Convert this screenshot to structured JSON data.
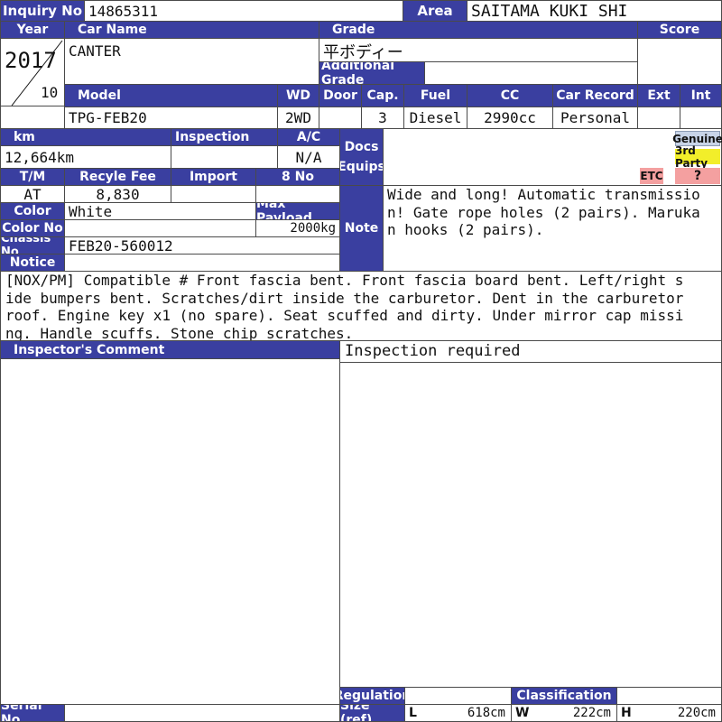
{
  "header": {
    "inquiry_label": "Inquiry No",
    "inquiry_no": "14865311",
    "area_label": "Area",
    "area": "SAITAMA KUKI SHI"
  },
  "row1": {
    "year_label": "Year",
    "car_name_label": "Car Name",
    "grade_label": "Grade",
    "score_label": "Score",
    "year": "2017",
    "month": "10",
    "car_name": "CANTER",
    "grade": "平ボディー",
    "additional_grade_label": "Additional Grade",
    "additional_grade": "",
    "score": ""
  },
  "row2": {
    "model_label": "Model",
    "wd_label": "WD",
    "door_label": "Door",
    "cap_label": "Cap.",
    "fuel_label": "Fuel",
    "cc_label": "CC",
    "car_record_label": "Car Record",
    "ext_label": "Ext",
    "int_label": "Int",
    "model": "TPG-FEB20",
    "wd": "2WD",
    "door": "",
    "cap": "3",
    "fuel": "Diesel",
    "cc": "2990cc",
    "car_record": "Personal",
    "ext": "",
    "int": ""
  },
  "details": {
    "km_label": "km",
    "km": "12,664km",
    "inspection_label": "Inspection",
    "inspection": "",
    "ac_label": "A/C",
    "ac": "N/A",
    "docs_label": "Docs",
    "equips_label": "Equips",
    "tm_label": "T/M",
    "tm": "AT",
    "recycle_label": "Recyle Fee",
    "recycle": "8,830",
    "import_label": "Import",
    "import": "",
    "eight_no_label": "8 No",
    "eight_no": "",
    "color_label": "Color",
    "color": "White",
    "max_payload_label": "Max Payload",
    "max_payload": "2000kg",
    "color_no_label": "Color No",
    "color_no": "",
    "chassis_label": "Chassis No",
    "chassis": "FEB20-560012",
    "notice_label": "Notice",
    "note_label": "Note",
    "note": "Wide and long! Automatic transmission! Gate rope holes (2 pairs). Marukan hooks (2 pairs)."
  },
  "badges": {
    "genuine": "Genuine",
    "genuine_color": "#c8d4e8",
    "third_party": "3rd Party",
    "third_party_color": "#f2ee2a",
    "etc": "ETC",
    "etc_color": "#f4a0a0",
    "question": "?",
    "question_color": "#f4a0a0"
  },
  "notice_text": "[NOX/PM] Compatible # Front fascia bent. Front fascia board bent. Left/right side bumpers bent. Scratches/dirt inside the carburetor. Dent in the carburetor roof. Engine key x1 (no spare). Seat scuffed and dirty. Under mirror cap missing. Handle scuffs. Stone chip scratches.",
  "inspector": {
    "label": "Inspector's Comment",
    "comment": "Inspection required"
  },
  "footer": {
    "serial_label": "Serial No",
    "serial": "",
    "regulation_label": "Regulation",
    "regulation": "",
    "classification_label": "Classification",
    "classification": "",
    "size_label": "Size (ref)",
    "l_label": "L",
    "l_value": "618cm",
    "w_label": "W",
    "w_value": "222cm",
    "h_label": "H",
    "h_value": "220cm"
  }
}
